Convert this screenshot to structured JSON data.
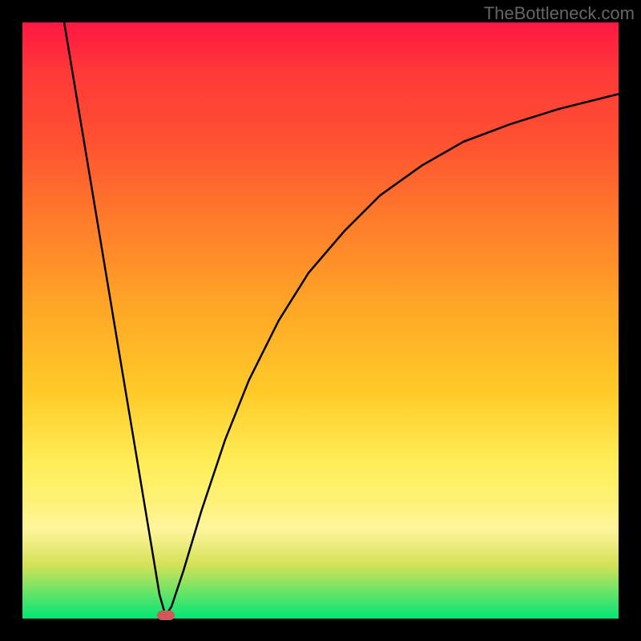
{
  "watermark": "TheBottleneck.com",
  "chart_data": {
    "type": "line",
    "title": "",
    "xlabel": "",
    "ylabel": "",
    "xlim": [
      0,
      100
    ],
    "ylim": [
      0,
      100
    ],
    "marker": {
      "x": 24,
      "y": 0.5
    },
    "curve_points": [
      {
        "x": 7,
        "y": 100
      },
      {
        "x": 10,
        "y": 82
      },
      {
        "x": 13,
        "y": 64
      },
      {
        "x": 16,
        "y": 46
      },
      {
        "x": 19,
        "y": 28
      },
      {
        "x": 22,
        "y": 10
      },
      {
        "x": 23,
        "y": 4
      },
      {
        "x": 24,
        "y": 0.5
      },
      {
        "x": 25,
        "y": 2
      },
      {
        "x": 27,
        "y": 8
      },
      {
        "x": 30,
        "y": 18
      },
      {
        "x": 34,
        "y": 30
      },
      {
        "x": 38,
        "y": 40
      },
      {
        "x": 43,
        "y": 50
      },
      {
        "x": 48,
        "y": 58
      },
      {
        "x": 54,
        "y": 65
      },
      {
        "x": 60,
        "y": 71
      },
      {
        "x": 67,
        "y": 76
      },
      {
        "x": 74,
        "y": 80
      },
      {
        "x": 82,
        "y": 83
      },
      {
        "x": 90,
        "y": 85.5
      },
      {
        "x": 100,
        "y": 88
      }
    ],
    "gradient_info": "vertical gradient from red (top, high bottleneck) through orange and yellow to green (bottom, optimal)"
  }
}
